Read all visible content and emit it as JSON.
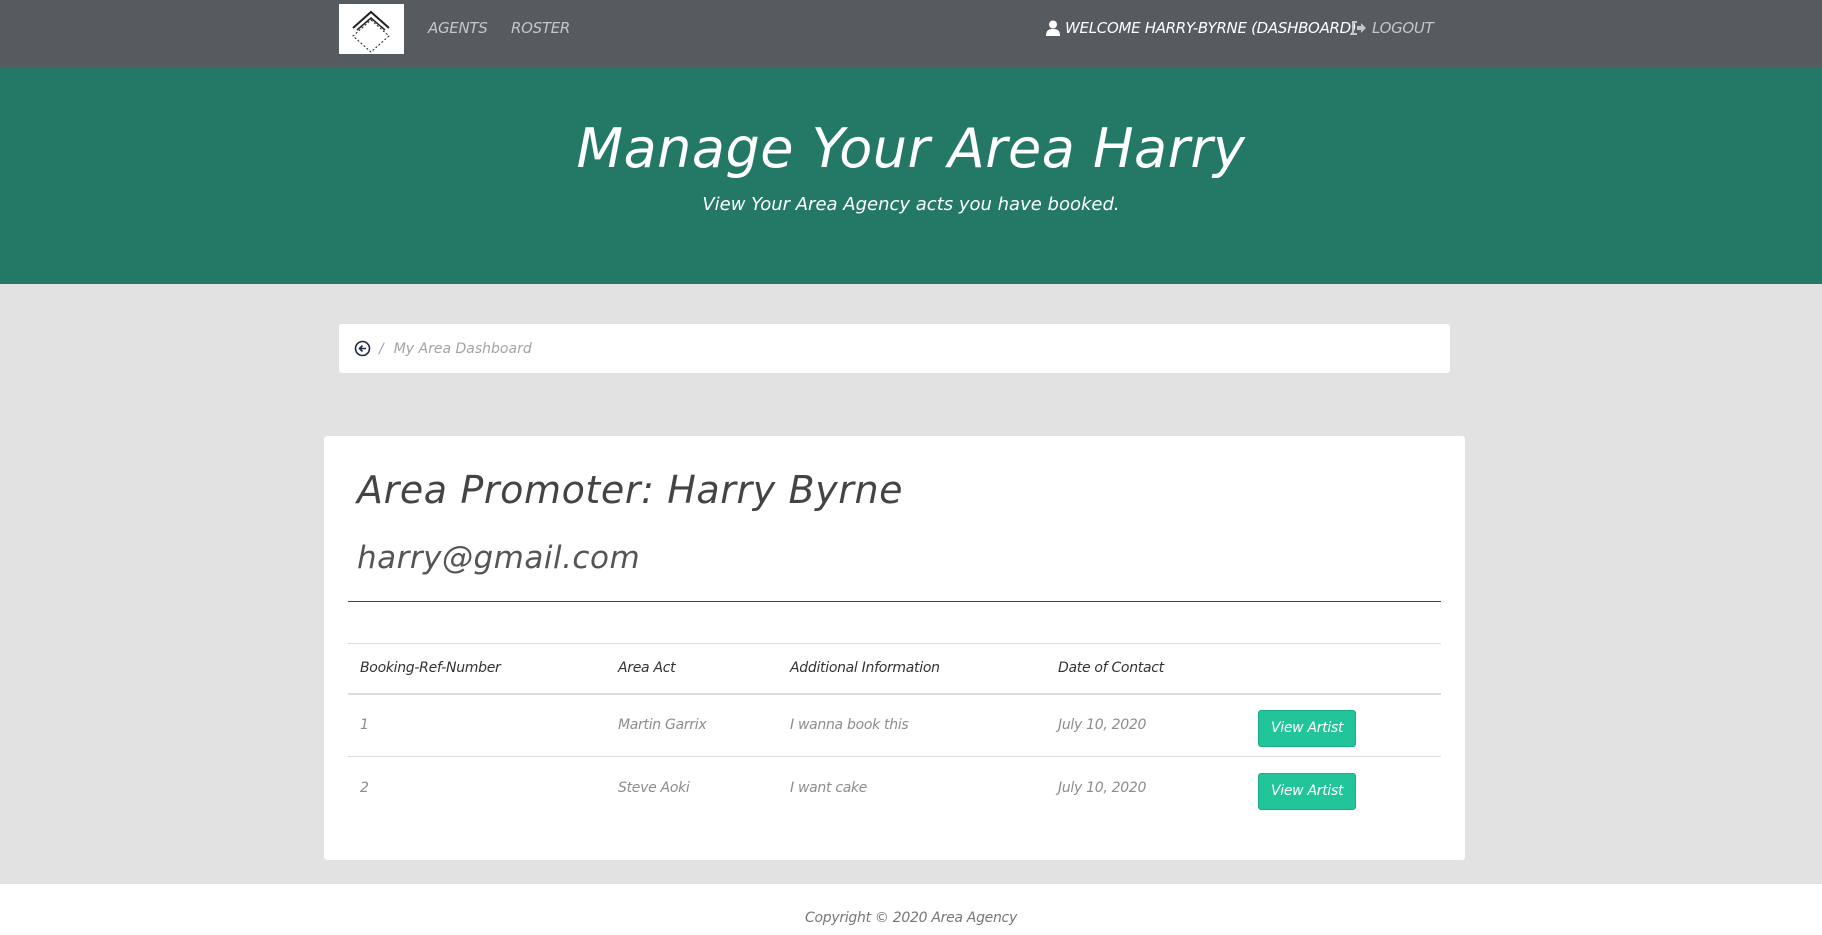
{
  "nav": {
    "logo_icon": "diamond-logo-icon",
    "links": [
      "AGENTS",
      "ROSTER"
    ],
    "welcome": "WELCOME HARRY-BYRNE (DASHBOARD)",
    "user_icon": "user-icon",
    "logout": "LOGOUT",
    "logout_icon": "sign-out-icon"
  },
  "hero": {
    "title": "Manage Your Area Harry",
    "subtitle": "View Your Area Agency acts you have booked.",
    "background_color": "#247866"
  },
  "breadcrumb": {
    "back_icon": "circle-arrow-left-icon",
    "separator": "/",
    "current": "My Area Dashboard"
  },
  "promoter": {
    "title": "Area Promoter: Harry Byrne",
    "email": "harry@gmail.com"
  },
  "table": {
    "headers": [
      "Booking-Ref-Number",
      "Area Act",
      "Additional Information",
      "Date of Contact",
      ""
    ],
    "rows": [
      {
        "ref": "1",
        "act": "Martin Garrix",
        "info": "I wanna book this",
        "date": "July 10, 2020",
        "action": "View Artist"
      },
      {
        "ref": "2",
        "act": "Steve Aoki",
        "info": "I want cake",
        "date": "July 10, 2020",
        "action": "View Artist"
      }
    ],
    "button_color": "#22c49a"
  },
  "footer": {
    "copyright": "Copyright © 2020 Area Agency"
  }
}
